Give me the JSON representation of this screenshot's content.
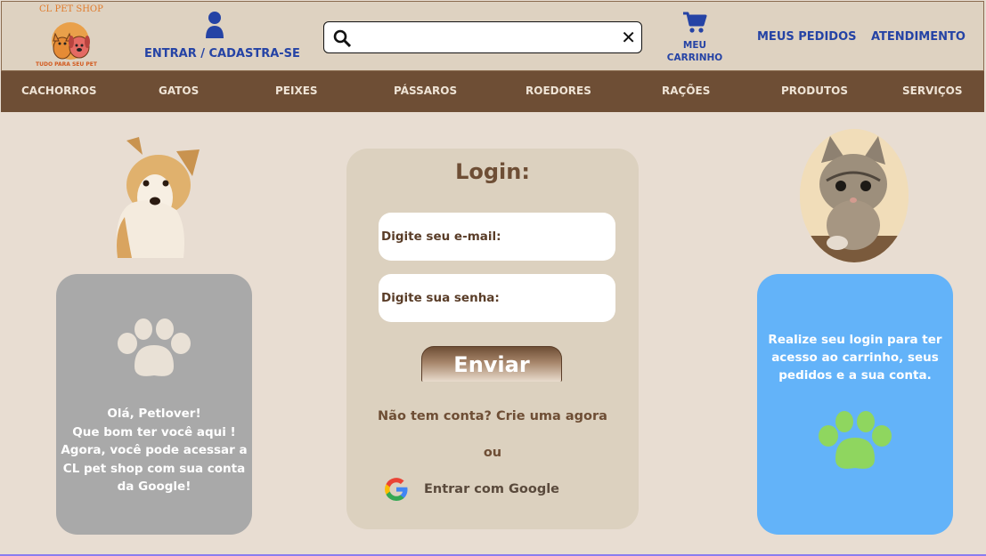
{
  "header": {
    "logo": {
      "title": "CL PET SHOP",
      "tagline": "TUDO PARA SEU PET"
    },
    "login_label": "ENTRAR / CADASTRA-SE",
    "search": {
      "value": "",
      "placeholder": ""
    },
    "cart_label_line1": "MEU",
    "cart_label_line2": "CARRINHO",
    "orders_label": "MEUS PEDIDOS",
    "support_label": "ATENDIMENTO"
  },
  "nav": {
    "items": [
      {
        "label": "CACHORROS"
      },
      {
        "label": "GATOS"
      },
      {
        "label": "PEIXES"
      },
      {
        "label": "PÁSSAROS"
      },
      {
        "label": "ROEDORES"
      },
      {
        "label": "RAÇÕES"
      },
      {
        "label": "PRODUTOS"
      },
      {
        "label": "SERVIÇOS"
      }
    ]
  },
  "left_card": {
    "line1": "Olá, Petlover!",
    "line2": "Que bom ter você aqui !",
    "line3": "Agora, você pode acessar a",
    "line4": "CL pet shop com sua conta",
    "line5": "da Google!"
  },
  "login": {
    "title": "Login:",
    "email_placeholder": "Digite seu e-mail:",
    "password_placeholder": "Digite sua senha:",
    "submit_label": "Enviar",
    "no_account_text": "Não tem conta? Crie uma agora",
    "or_text": "ou",
    "google_label": "Entrar com Google"
  },
  "right_card": {
    "line1": "Realize seu login para ter",
    "line2": "acesso ao carrinho, seus",
    "line3": "pedidos e a sua conta."
  },
  "colors": {
    "header_bg": "#ded2c1",
    "nav_bg": "#6e4e35",
    "page_bg": "#e8ddd2",
    "link_blue": "#2543a5",
    "left_card": "#a9a9a9",
    "right_card": "#63b3f9",
    "paw_green": "#8fd65f",
    "login_box": "#dcd1bf"
  }
}
